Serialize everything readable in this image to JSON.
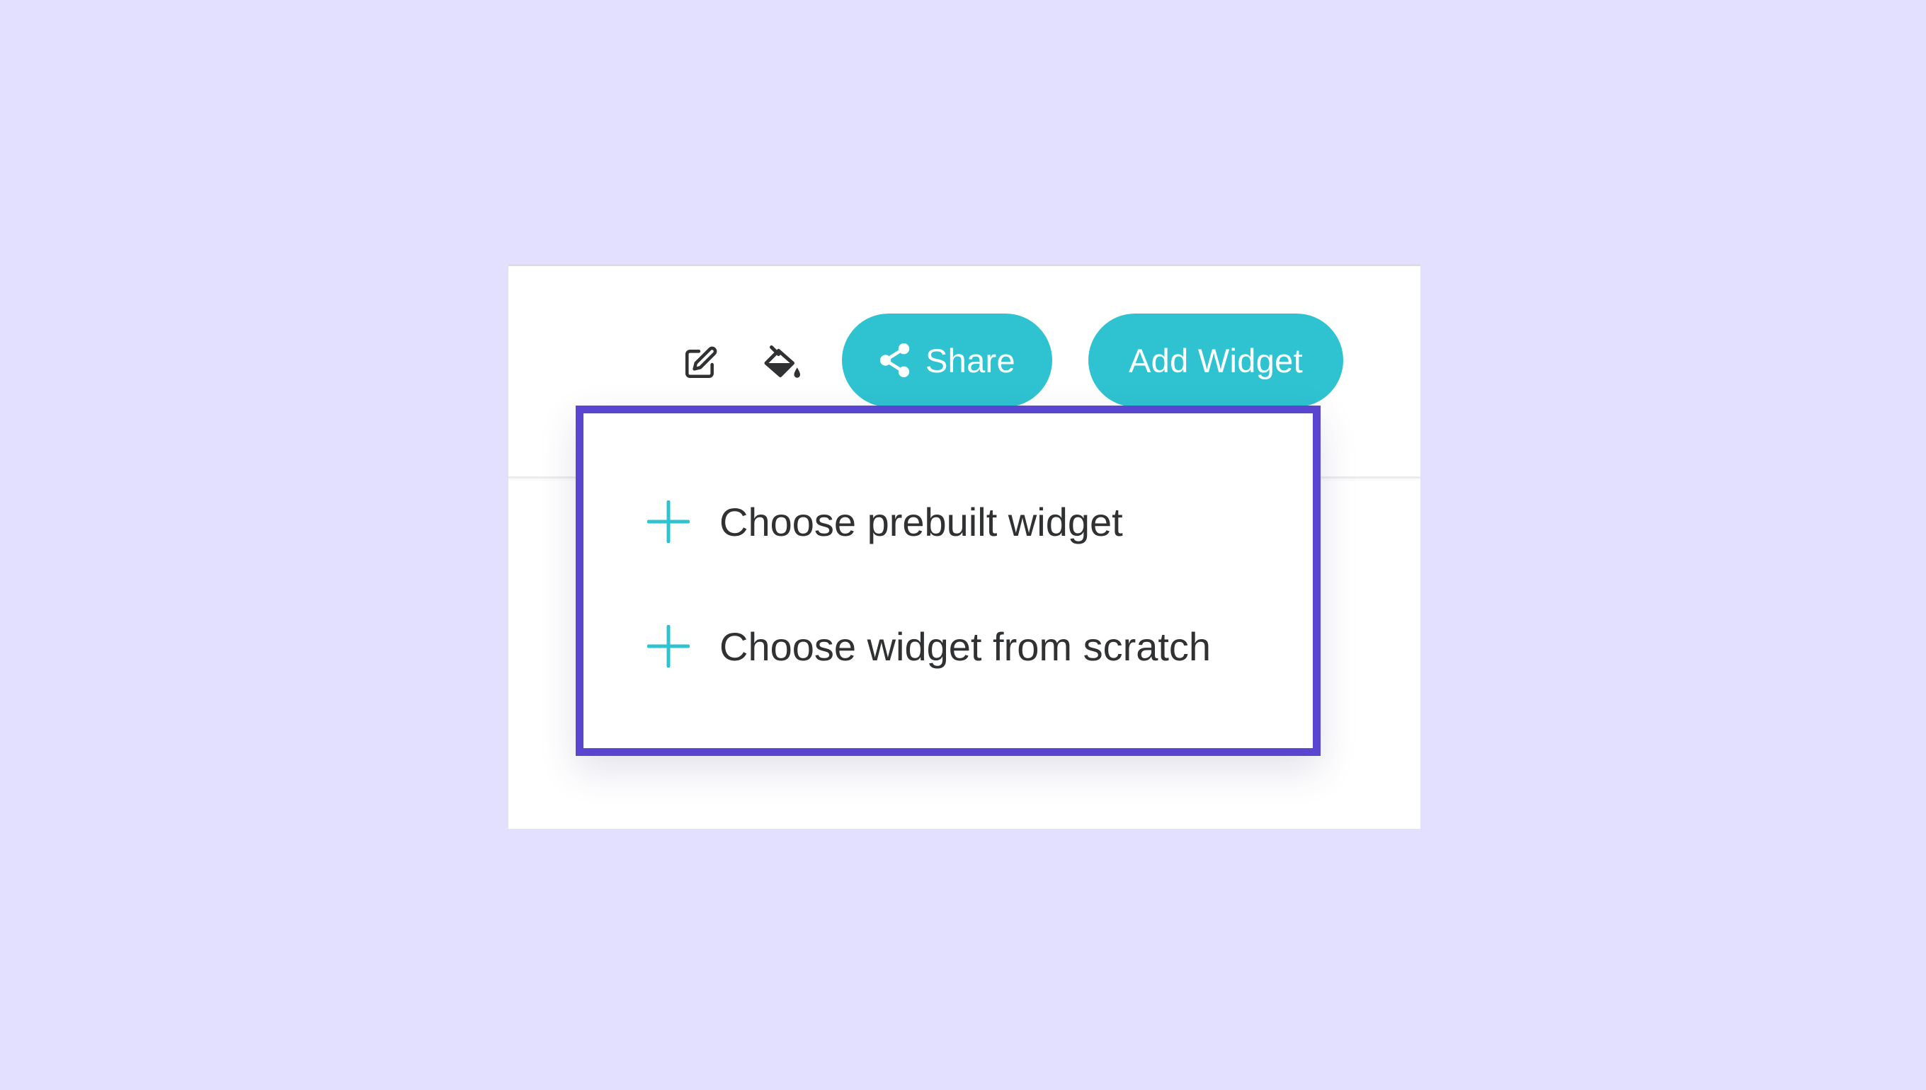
{
  "colors": {
    "page_background": "#e3dfff",
    "accent": "#2fc3d1",
    "highlight_border": "#5a45d0",
    "text": "#2f3133",
    "icon": "#2f3133"
  },
  "toolbar": {
    "edit_icon": "edit-icon",
    "paint_icon": "paint-bucket-icon",
    "share_icon": "share-icon",
    "share_label": "Share",
    "add_widget_label": "Add Widget"
  },
  "dropdown": {
    "items": [
      {
        "icon": "plus-icon",
        "label": "Choose prebuilt widget"
      },
      {
        "icon": "plus-icon",
        "label": "Choose widget from scratch"
      }
    ]
  }
}
